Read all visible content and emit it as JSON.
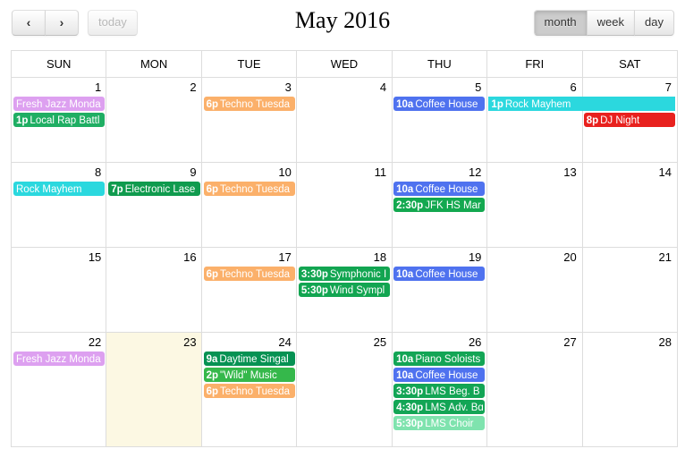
{
  "toolbar": {
    "prev_label": "‹",
    "next_label": "›",
    "today_label": "today",
    "title": "May 2016",
    "views": [
      {
        "label": "month",
        "active": true
      },
      {
        "label": "week",
        "active": false
      },
      {
        "label": "day",
        "active": false
      }
    ]
  },
  "calendar": {
    "day_headers": [
      "SUN",
      "MON",
      "TUE",
      "WED",
      "THU",
      "FRI",
      "SAT"
    ],
    "weeks": [
      {
        "days": [
          {
            "num": "1",
            "today": false
          },
          {
            "num": "2",
            "today": false
          },
          {
            "num": "3",
            "today": false
          },
          {
            "num": "4",
            "today": false
          },
          {
            "num": "5",
            "today": false
          },
          {
            "num": "6",
            "today": false
          },
          {
            "num": "7",
            "today": false
          }
        ],
        "events": [
          {
            "row": 0,
            "col": 0,
            "span": 1,
            "time": "",
            "title": "Fresh Jazz Monda",
            "color": "#DDA0F0"
          },
          {
            "row": 0,
            "col": 2,
            "span": 1,
            "time": "6p",
            "title": "Techno Tuesda",
            "color": "#FBB06A"
          },
          {
            "row": 0,
            "col": 4,
            "span": 1,
            "time": "10a",
            "title": "Coffee House",
            "color": "#4F72EF"
          },
          {
            "row": 0,
            "col": 5,
            "span": 2,
            "time": "1p",
            "title": "Rock Mayhem",
            "color": "#2BD8DE"
          },
          {
            "row": 1,
            "col": 0,
            "span": 1,
            "time": "1p",
            "title": "Local Rap Battl",
            "color": "#1FAE63"
          },
          {
            "row": 1,
            "col": 6,
            "span": 1,
            "time": "8p",
            "title": "DJ Night",
            "color": "#E8211E"
          }
        ]
      },
      {
        "days": [
          {
            "num": "8",
            "today": false
          },
          {
            "num": "9",
            "today": false
          },
          {
            "num": "10",
            "today": false
          },
          {
            "num": "11",
            "today": false
          },
          {
            "num": "12",
            "today": false
          },
          {
            "num": "13",
            "today": false
          },
          {
            "num": "14",
            "today": false
          }
        ],
        "events": [
          {
            "row": 0,
            "col": 0,
            "span": 1,
            "time": "",
            "title": "Rock Mayhem",
            "color": "#2BD8DE"
          },
          {
            "row": 0,
            "col": 1,
            "span": 1,
            "time": "7p",
            "title": "Electronic Lase",
            "color": "#109B4E"
          },
          {
            "row": 0,
            "col": 2,
            "span": 1,
            "time": "6p",
            "title": "Techno Tuesda",
            "color": "#FBB06A"
          },
          {
            "row": 0,
            "col": 4,
            "span": 1,
            "time": "10a",
            "title": "Coffee House",
            "color": "#4F72EF"
          },
          {
            "row": 1,
            "col": 4,
            "span": 1,
            "time": "2:30p",
            "title": "JFK HS Mar",
            "color": "#13A84F"
          }
        ]
      },
      {
        "days": [
          {
            "num": "15",
            "today": false
          },
          {
            "num": "16",
            "today": false
          },
          {
            "num": "17",
            "today": false
          },
          {
            "num": "18",
            "today": false
          },
          {
            "num": "19",
            "today": false
          },
          {
            "num": "20",
            "today": false
          },
          {
            "num": "21",
            "today": false
          }
        ],
        "events": [
          {
            "row": 0,
            "col": 2,
            "span": 1,
            "time": "6p",
            "title": "Techno Tuesda",
            "color": "#FBB06A"
          },
          {
            "row": 0,
            "col": 3,
            "span": 1,
            "time": "3:30p",
            "title": "Symphonic I",
            "color": "#12A551"
          },
          {
            "row": 0,
            "col": 4,
            "span": 1,
            "time": "10a",
            "title": "Coffee House",
            "color": "#4F72EF"
          },
          {
            "row": 1,
            "col": 3,
            "span": 1,
            "time": "5:30p",
            "title": "Wind Sympl",
            "color": "#12A551"
          }
        ]
      },
      {
        "days": [
          {
            "num": "22",
            "today": false
          },
          {
            "num": "23",
            "today": true
          },
          {
            "num": "24",
            "today": false
          },
          {
            "num": "25",
            "today": false
          },
          {
            "num": "26",
            "today": false
          },
          {
            "num": "27",
            "today": false
          },
          {
            "num": "28",
            "today": false
          }
        ],
        "events": [
          {
            "row": 0,
            "col": 0,
            "span": 1,
            "time": "",
            "title": "Fresh Jazz Monda",
            "color": "#DDA0F0"
          },
          {
            "row": 0,
            "col": 2,
            "span": 1,
            "time": "9a",
            "title": "Daytime Singal",
            "color": "#069253"
          },
          {
            "row": 0,
            "col": 4,
            "span": 1,
            "time": "10a",
            "title": "Piano Soloists",
            "color": "#13A555"
          },
          {
            "row": 1,
            "col": 2,
            "span": 1,
            "time": "2p",
            "title": "\"Wild\" Music",
            "color": "#35B84B"
          },
          {
            "row": 1,
            "col": 4,
            "span": 1,
            "time": "10a",
            "title": "Coffee House",
            "color": "#4F72EF"
          },
          {
            "row": 2,
            "col": 2,
            "span": 1,
            "time": "6p",
            "title": "Techno Tuesda",
            "color": "#FBB06A"
          },
          {
            "row": 2,
            "col": 4,
            "span": 1,
            "time": "3:30p",
            "title": "LMS Beg. B",
            "color": "#13A555"
          },
          {
            "row": 3,
            "col": 4,
            "span": 1,
            "time": "4:30p",
            "title": "LMS Adv. Bɑ",
            "color": "#13A555"
          },
          {
            "row": 4,
            "col": 4,
            "span": 1,
            "time": "5:30p",
            "title": "LMS Choir",
            "color": "#7FE3AE"
          }
        ]
      }
    ]
  }
}
